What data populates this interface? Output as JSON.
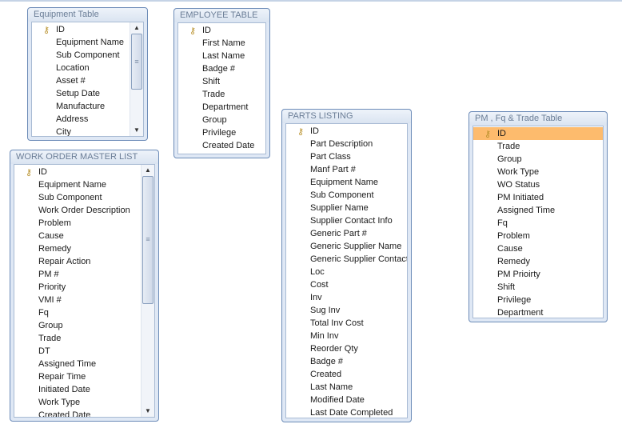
{
  "tables": [
    {
      "id": "t-equipment",
      "name": "equipment-table",
      "title": "Equipment Table",
      "scroll": {
        "thumb_start": 0.0,
        "thumb_size": 0.6
      },
      "fields": [
        "ID",
        "Equipment Name",
        "Sub Component",
        "Location",
        "Asset #",
        "Setup Date",
        "Manufacture",
        "Address",
        "City"
      ]
    },
    {
      "id": "t-employee",
      "name": "employee-table",
      "title": "EMPLOYEE TABLE",
      "fields": [
        "ID",
        "First Name",
        "Last Name",
        "Badge #",
        "Shift",
        "Trade",
        "Department",
        "Group",
        "Privilege",
        "Created Date"
      ]
    },
    {
      "id": "t-workorder",
      "name": "work-order-master-list",
      "title": "WORK ORDER MASTER LIST",
      "scroll": {
        "thumb_start": 0.0,
        "thumb_size": 0.55
      },
      "fields": [
        "ID",
        "Equipment Name",
        "Sub Component",
        "Work Order Description",
        "Problem",
        "Cause",
        "Remedy",
        "Repair Action",
        "PM #",
        "Priority",
        "VMI #",
        "Fq",
        "Group",
        "Trade",
        "DT",
        "Assigned Time",
        "Repair Time",
        "Initiated Date",
        "Work Type",
        "Created Date"
      ]
    },
    {
      "id": "t-parts",
      "name": "parts-listing",
      "title": "PARTS LISTING",
      "fields": [
        "ID",
        "Part Description",
        "Part Class",
        "Manf Part #",
        "Equipment Name",
        "Sub Component",
        "Supplier Name",
        "Supplier Contact Info",
        "Generic Part #",
        "Generic Supplier Name",
        "Generic Supplier Contact",
        "Loc",
        "Cost",
        "Inv",
        "Sug  Inv",
        "Total Inv Cost",
        "Min Inv",
        "Reorder Qty",
        "Badge #",
        "Created",
        "Last Name",
        "Modified Date",
        "Last Date Completed"
      ]
    },
    {
      "id": "t-pm",
      "name": "pm-fq-trade-table",
      "title": "PM , Fq  & Trade Table",
      "selected": "ID",
      "fields": [
        "ID",
        "Trade",
        "Group",
        "Work Type",
        "WO Status",
        "PM Initiated",
        "Assigned Time",
        "Fq",
        "Problem",
        "Cause",
        "Remedy",
        "PM Prioirty",
        "Shift",
        "Privilege",
        "Department"
      ]
    }
  ],
  "icons": {
    "primary_key": "key-icon",
    "scroll_up": "arrow-up-icon",
    "scroll_down": "arrow-down-icon"
  },
  "colors": {
    "selection": "#fdbb6d",
    "border": "#6d8cb8"
  }
}
